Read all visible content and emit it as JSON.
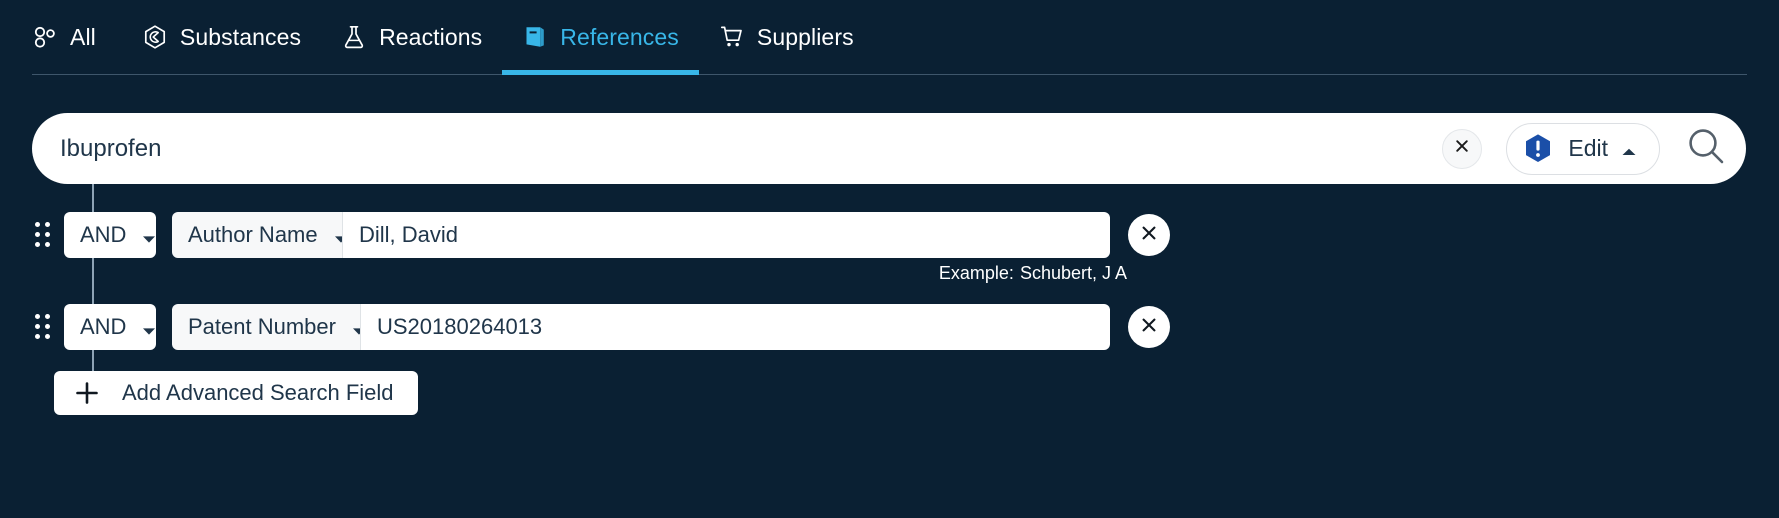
{
  "tabs": [
    {
      "label": "All",
      "icon": "nodes-icon",
      "active": false
    },
    {
      "label": "Substances",
      "icon": "hexagon-molecule-icon",
      "active": false
    },
    {
      "label": "Reactions",
      "icon": "flask-icon",
      "active": false
    },
    {
      "label": "References",
      "icon": "book-icon",
      "active": true
    },
    {
      "label": "Suppliers",
      "icon": "shopping-cart-icon",
      "active": false
    }
  ],
  "search": {
    "value": "Ibuprofen",
    "placeholder": "Search",
    "clear_icon": "close-icon",
    "edit_label": "Edit",
    "edit_badge_icon": "hexagon-exclamation-icon",
    "edit_caret_icon": "chevron-up-icon",
    "search_icon": "search-icon"
  },
  "advanced_rows": [
    {
      "drag_icon": "drag-handle-icon",
      "operator": "AND",
      "operator_caret_icon": "chevron-down-icon",
      "field": "Author Name",
      "field_caret_icon": "chevron-down-icon",
      "value": "Dill, David",
      "placeholder": "",
      "remove_icon": "close-icon",
      "example_label": "Example:",
      "example_value": "Schubert, J A"
    },
    {
      "drag_icon": "drag-handle-icon",
      "operator": "AND",
      "operator_caret_icon": "chevron-down-icon",
      "field": "Patent Number",
      "field_caret_icon": "chevron-down-icon",
      "value": "US20180264013",
      "placeholder": "",
      "remove_icon": "close-icon"
    }
  ],
  "add_field_button": {
    "label": "Add Advanced Search Field",
    "icon": "plus-icon"
  },
  "colors": {
    "background": "#0a2033",
    "accent": "#38b6e8",
    "text_on_dark": "#ffffff",
    "text_on_light": "#20364a",
    "badge_blue": "#1b4fa8",
    "panel_white": "#ffffff"
  }
}
